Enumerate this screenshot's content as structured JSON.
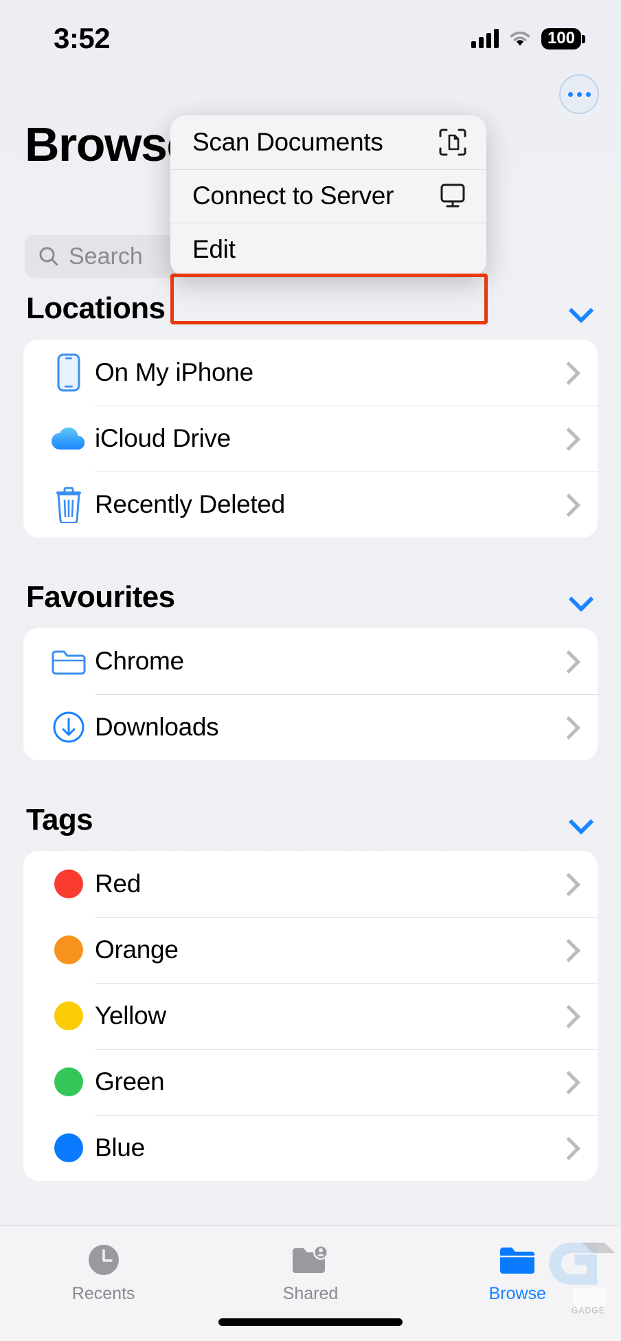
{
  "statusbar": {
    "time": "3:52",
    "signal_icon": "cellular-bars-icon",
    "wifi_icon": "wifi-icon",
    "battery_level": "100"
  },
  "header": {
    "title": "Browse",
    "more_button_label": "more-options",
    "more_icon": "ellipsis-circle-icon"
  },
  "search": {
    "placeholder": "Search",
    "value": "",
    "icon": "search-icon"
  },
  "menu": {
    "items": [
      {
        "label": "Scan Documents",
        "icon": "scan-document-icon",
        "highlighted": false
      },
      {
        "label": "Connect to Server",
        "icon": "monitor-icon",
        "highlighted": false
      },
      {
        "label": "Edit",
        "icon": "",
        "highlighted": true
      }
    ],
    "highlight_color": "#e8380d"
  },
  "sections": [
    {
      "title": "Locations",
      "collapse_icon": "chevron-down-icon",
      "items": [
        {
          "label": "On My iPhone",
          "icon": "iphone-icon",
          "accessory": "chevron-right-icon"
        },
        {
          "label": "iCloud Drive",
          "icon": "icloud-icon",
          "accessory": "chevron-right-icon"
        },
        {
          "label": "Recently Deleted",
          "icon": "trash-icon",
          "accessory": "chevron-right-icon"
        }
      ]
    },
    {
      "title": "Favourites",
      "collapse_icon": "chevron-down-icon",
      "items": [
        {
          "label": "Chrome",
          "icon": "folder-icon",
          "accessory": "chevron-right-icon"
        },
        {
          "label": "Downloads",
          "icon": "download-circle-icon",
          "accessory": "chevron-right-icon"
        }
      ]
    },
    {
      "title": "Tags",
      "collapse_icon": "chevron-down-icon",
      "items": [
        {
          "label": "Red",
          "icon": "color-dot-icon",
          "color": "#fa3b30",
          "accessory": "chevron-right-icon"
        },
        {
          "label": "Orange",
          "icon": "color-dot-icon",
          "color": "#f7921e",
          "accessory": "chevron-right-icon"
        },
        {
          "label": "Yellow",
          "icon": "color-dot-icon",
          "color": "#fecc07",
          "accessory": "chevron-right-icon"
        },
        {
          "label": "Green",
          "icon": "color-dot-icon",
          "color": "#33c759",
          "accessory": "chevron-right-icon"
        },
        {
          "label": "Blue",
          "icon": "color-dot-icon",
          "color": "#0a7aff",
          "accessory": "chevron-right-icon"
        }
      ]
    }
  ],
  "tabbar": {
    "tabs": [
      {
        "label": "Recents",
        "icon": "clock-icon",
        "active": false
      },
      {
        "label": "Shared",
        "icon": "shared-folder-icon",
        "active": false
      },
      {
        "label": "Browse",
        "icon": "folder-filled-icon",
        "active": true
      }
    ],
    "active_color": "#1a84ff",
    "inactive_color": "#8a8a8e"
  }
}
